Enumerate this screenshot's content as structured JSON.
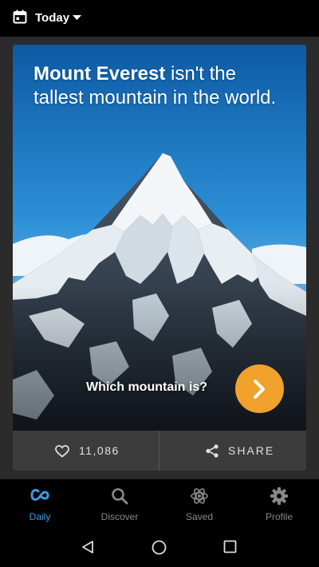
{
  "topbar": {
    "title": "Today",
    "calendar_icon": "calendar-icon",
    "dropdown_icon": "caret-down-icon"
  },
  "card": {
    "headline_bold": "Mount Everest",
    "headline_rest": " isn't the tallest mountain in the world.",
    "question": "Which mountain is?",
    "next_icon": "chevron-right-icon",
    "likes": "11,086",
    "share_label": "SHARE",
    "heart_icon": "heart-outline-icon",
    "share_icon": "share-icon"
  },
  "bottom_nav": {
    "items": [
      {
        "label": "Daily",
        "icon": "daily-infinity-icon",
        "active": true
      },
      {
        "label": "Discover",
        "icon": "search-icon",
        "active": false
      },
      {
        "label": "Saved",
        "icon": "atom-icon",
        "active": false
      },
      {
        "label": "Profile",
        "icon": "gear-icon",
        "active": false
      }
    ]
  },
  "system_nav": {
    "back_icon": "back-triangle-icon",
    "home_icon": "home-circle-icon",
    "recents_icon": "recents-square-icon"
  },
  "colors": {
    "accent": "#3a9be0",
    "next_button": "#f0a22c",
    "card_footer": "#3c3c3c",
    "background": "#2b2b2b"
  }
}
